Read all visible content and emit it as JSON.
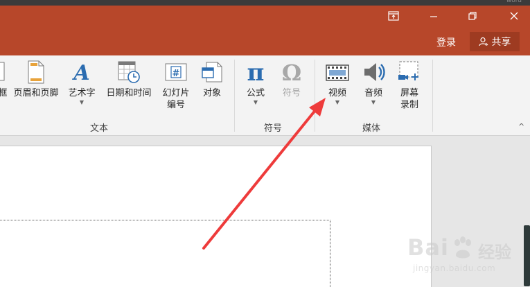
{
  "window": {
    "top_faint_text": "word",
    "login_label": "登录",
    "share_label": "共享"
  },
  "ribbon": {
    "buttons": [
      {
        "label": "框",
        "icon": "textbox-icon"
      },
      {
        "label": "页眉和页脚",
        "icon": "header-footer-icon"
      },
      {
        "label": "艺术字",
        "icon": "wordart-icon"
      },
      {
        "label": "日期和时间",
        "icon": "date-time-icon"
      },
      {
        "label": "幻灯片\n编号",
        "label_line1": "幻灯片",
        "label_line2": "编号",
        "icon": "slide-number-icon"
      },
      {
        "label": "对象",
        "icon": "object-icon"
      },
      {
        "label": "公式",
        "icon": "pi-icon"
      },
      {
        "label": "符号",
        "icon": "omega-icon"
      },
      {
        "label": "视频",
        "icon": "video-icon"
      },
      {
        "label": "音频",
        "icon": "audio-icon"
      },
      {
        "label_line1": "屏幕",
        "label_line2": "录制",
        "icon": "screen-record-icon"
      }
    ],
    "groups": {
      "text": "文本",
      "symbols": "符号",
      "media": "媒体"
    }
  },
  "watermark": {
    "brand": "Bai",
    "brand2": "经验",
    "url": "jingyan.baidu.com"
  },
  "colors": {
    "titlebar": "#b7472a",
    "share_bg": "#9e3b21",
    "ribbon_bg": "#f3f3f3",
    "accent_blue": "#2b6cb0",
    "arrow_red": "#ee3b3b"
  }
}
